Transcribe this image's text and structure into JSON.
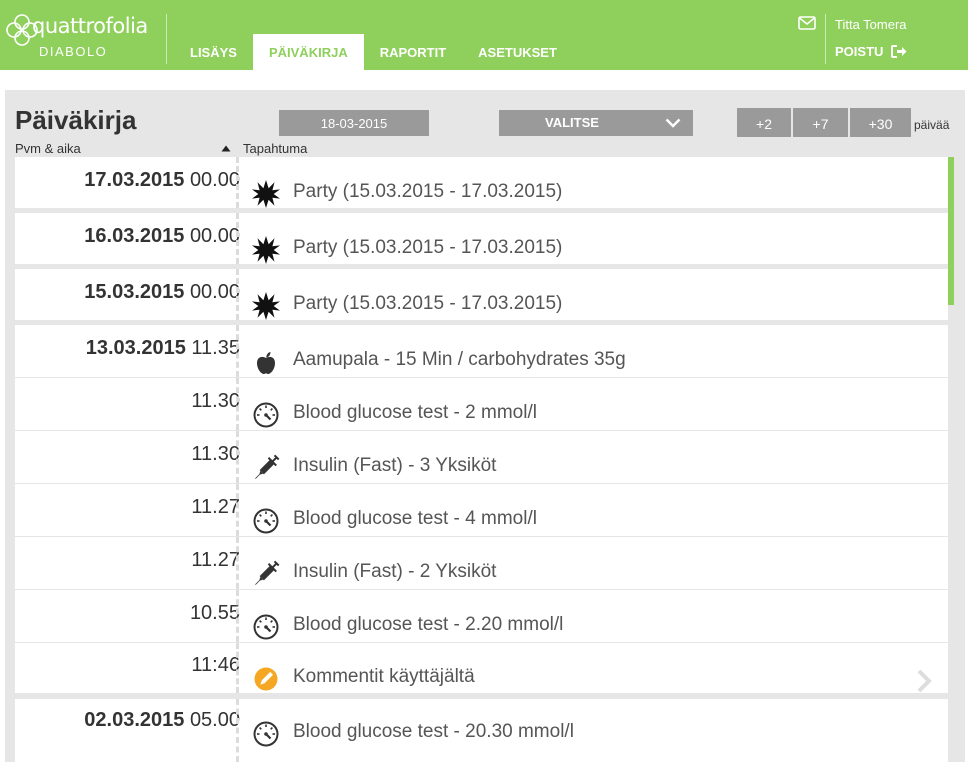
{
  "brand": {
    "logo_text": "quattrofolia",
    "subtitle": "DIABOLO"
  },
  "nav": {
    "tabs": [
      {
        "label": "LISÄYS",
        "active": false
      },
      {
        "label": "PÄIVÄKIRJA",
        "active": true
      },
      {
        "label": "RAPORTIT",
        "active": false
      },
      {
        "label": "ASETUKSET",
        "active": false
      }
    ]
  },
  "user": {
    "name": "Titta Tomera",
    "logout_label": "POISTU"
  },
  "page": {
    "title": "Päiväkirja",
    "date_value": "18-03-2015",
    "select_label": "VALITSE",
    "day_buttons": [
      "+2",
      "+7",
      "+30"
    ],
    "days_unit": "päivää",
    "col_datetime": "Pvm & aika",
    "col_event": "Tapahtuma"
  },
  "colors": {
    "brand_green": "#8fd05c",
    "button_gray": "#9a9a9a",
    "panel_bg": "#e6e6e6",
    "comment_orange": "#f5a623"
  },
  "entries": [
    {
      "date": "17.03.2015",
      "time": "00.00",
      "icon": "party-icon",
      "text": "Party (15.03.2015 - 17.03.2015)"
    },
    {
      "date": "16.03.2015",
      "time": "00.00",
      "icon": "party-icon",
      "text": "Party (15.03.2015 - 17.03.2015)"
    },
    {
      "date": "15.03.2015",
      "time": "00.00",
      "icon": "party-icon",
      "text": "Party (15.03.2015 - 17.03.2015)"
    },
    {
      "date": "13.03.2015",
      "time": "11.35",
      "icon": "apple-icon",
      "text": "Aamupala - 15 Min / carbohydrates 35g"
    },
    {
      "date": "",
      "time": "11.30",
      "icon": "gauge-icon",
      "text": "Blood glucose test - 2 mmol/l"
    },
    {
      "date": "",
      "time": "11.30",
      "icon": "syringe-icon",
      "text": "Insulin (Fast) - 3 Yksiköt"
    },
    {
      "date": "",
      "time": "11.27",
      "icon": "gauge-icon",
      "text": "Blood glucose test - 4 mmol/l"
    },
    {
      "date": "",
      "time": "11.27",
      "icon": "syringe-icon",
      "text": "Insulin (Fast) - 2 Yksiköt"
    },
    {
      "date": "",
      "time": "10.55",
      "icon": "gauge-icon",
      "text": "Blood glucose test - 2.20 mmol/l"
    },
    {
      "date": "",
      "time": "11:46",
      "icon": "pencil-icon",
      "text": "Kommentit käyttäjältä"
    },
    {
      "date": "02.03.2015",
      "time": "05.00",
      "icon": "gauge-icon",
      "text": "Blood glucose test - 20.30 mmol/l"
    }
  ]
}
